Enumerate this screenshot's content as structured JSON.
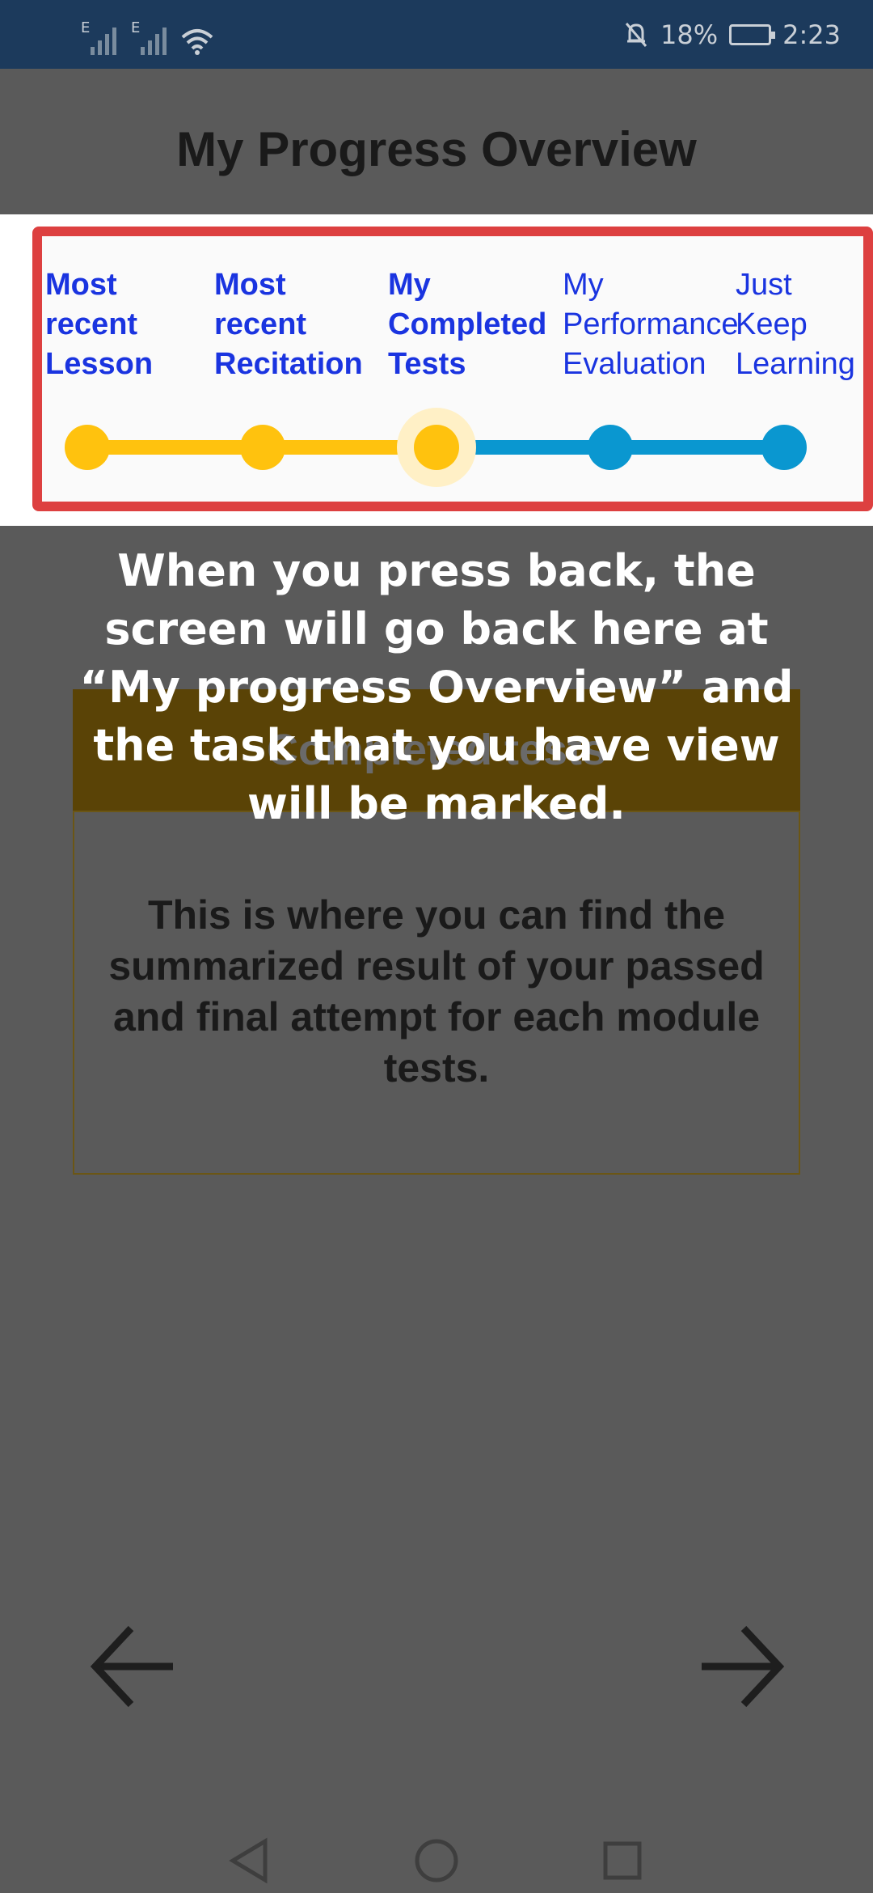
{
  "status_bar": {
    "network_left": "E",
    "network_right": "E",
    "battery_percent": "18%",
    "time": "2:23"
  },
  "header": {
    "title": "My Progress Overview"
  },
  "stepper": {
    "steps": [
      {
        "label": "Most\nrecent\nLesson",
        "completed": true
      },
      {
        "label": "Most\nrecent\nRecitation",
        "completed": true
      },
      {
        "label": "My\nCompleted\nTests",
        "completed": true,
        "current": true
      },
      {
        "label": "My\nPerformance\nEvaluation",
        "completed": false
      },
      {
        "label": "Just\nKeep\nLearning",
        "completed": false
      }
    ],
    "colors": {
      "done": "#ffc20e",
      "todo": "#0a97d0",
      "label": "#1a34e0",
      "highlight_border": "#dd4040"
    }
  },
  "overlay": {
    "message": "When you press back, the screen will go back here at “My progress Overview” and the task that you have view will be marked."
  },
  "card": {
    "title": "Completed tests",
    "description": "This is where you can find the summarized result of your passed and final attempt for each module tests."
  },
  "navigation": {
    "back_icon": "arrow-left-icon",
    "forward_icon": "arrow-right-icon"
  },
  "system_nav": {
    "back": "triangle-back-icon",
    "home": "circle-home-icon",
    "recents": "square-recents-icon"
  }
}
